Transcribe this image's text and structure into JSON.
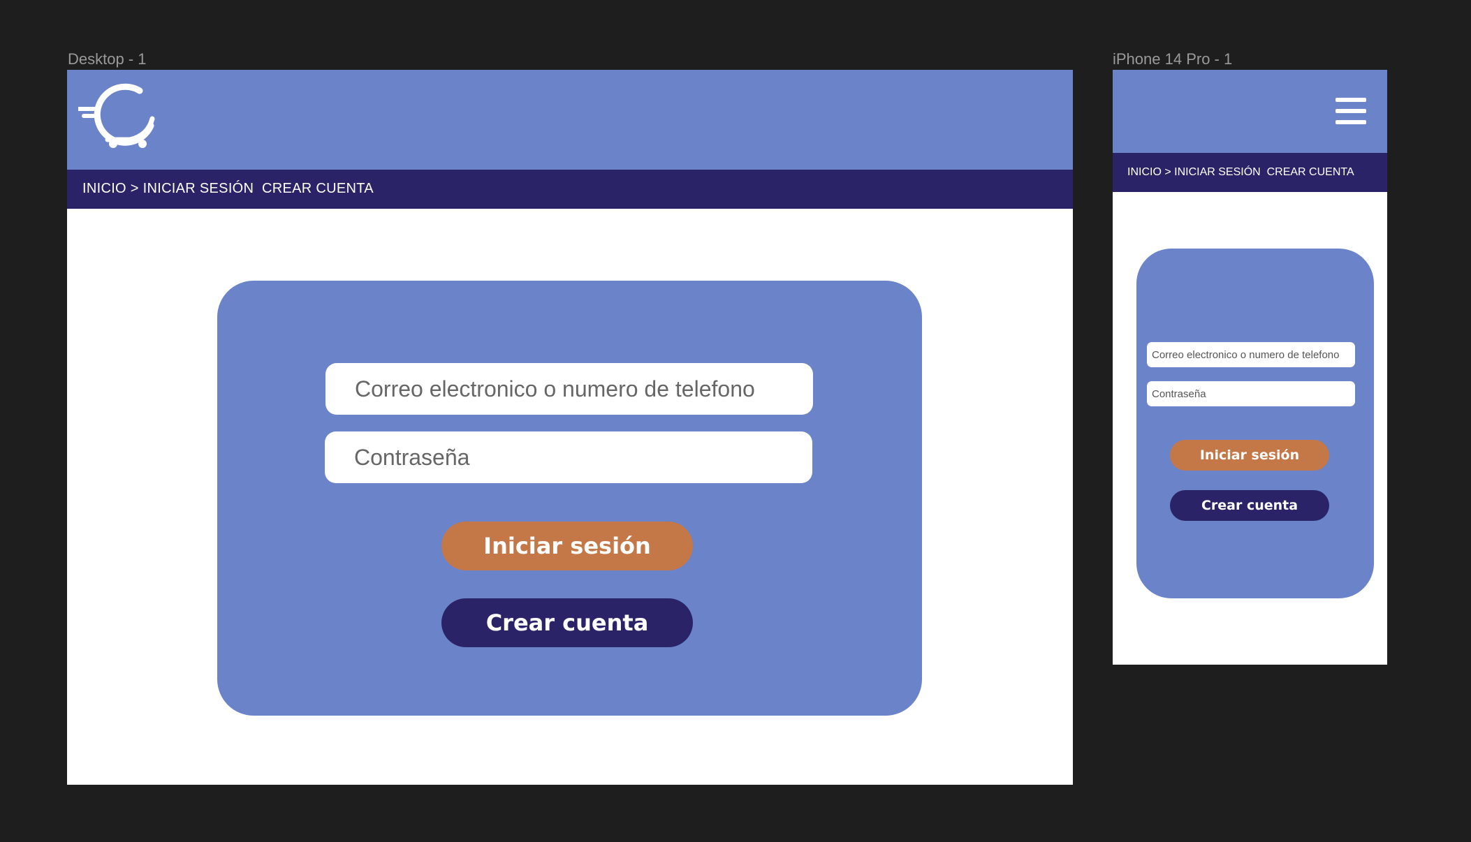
{
  "colors": {
    "canvas": "#1e1e1e",
    "header": "#6b84c9",
    "breadcrumb_bar": "#2b2368",
    "card": "#6b84c9",
    "login_button": "#c47747",
    "create_button": "#2b2368"
  },
  "desktop": {
    "frame_label": "Desktop - 1",
    "logo_icon": "cart-logo-icon",
    "breadcrumb": "INICIO > INICIAR SESIÓN  CREAR CUENTA",
    "email_placeholder": "Correo electronico o numero de telefono",
    "password_placeholder": "Contraseña",
    "login_label": "Iniciar sesión",
    "create_label": "Crear cuenta"
  },
  "phone": {
    "frame_label": "iPhone 14 Pro - 1",
    "menu_icon": "hamburger-menu-icon",
    "breadcrumb": "INICIO > INICIAR SESIÓN  CREAR CUENTA",
    "email_placeholder": "Correo electronico o numero de telefono",
    "password_placeholder": "Contraseña",
    "login_label": "Iniciar sesión",
    "create_label": "Crear cuenta"
  }
}
